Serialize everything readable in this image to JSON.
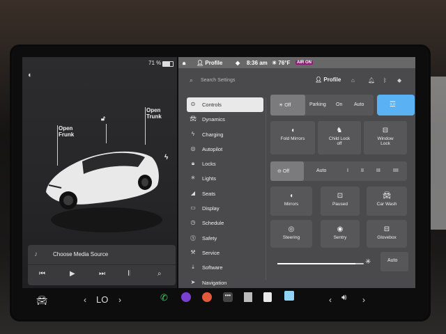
{
  "status": {
    "battery": "71 %",
    "profile_top": "Profile",
    "time": "8:36 am",
    "temp": "76°F",
    "airbag": "AIR ON"
  },
  "callouts": {
    "frunk": "Open\nFrunk",
    "trunk": "Open\nTrunk"
  },
  "media": {
    "label": "Choose Media Source"
  },
  "search": {
    "placeholder": "Search Settings"
  },
  "profile": {
    "label": "Profile"
  },
  "nav": [
    {
      "label": "Controls",
      "icon": "toggle-icon",
      "active": true
    },
    {
      "label": "Dynamics",
      "icon": "car-icon"
    },
    {
      "label": "Charging",
      "icon": "bolt-icon"
    },
    {
      "label": "Autopilot",
      "icon": "steering-icon"
    },
    {
      "label": "Locks",
      "icon": "lock-icon"
    },
    {
      "label": "Lights",
      "icon": "sun-icon"
    },
    {
      "label": "Seats",
      "icon": "seat-icon"
    },
    {
      "label": "Display",
      "icon": "display-icon"
    },
    {
      "label": "Schedule",
      "icon": "clock-icon"
    },
    {
      "label": "Safety",
      "icon": "shield-icon"
    },
    {
      "label": "Service",
      "icon": "wrench-icon"
    },
    {
      "label": "Software",
      "icon": "download-icon"
    },
    {
      "label": "Navigation",
      "icon": "navigation-icon"
    }
  ],
  "headlights": {
    "off": "Off",
    "parking": "Parking",
    "on": "On",
    "auto": "Auto"
  },
  "mirror_tiles": {
    "fold": "Fold Mirrors",
    "child": "Child Lock\noff",
    "window": "Window\nLock"
  },
  "wiper": {
    "off": "Off",
    "auto": "Auto",
    "s1": "I",
    "s2": "II",
    "s3": "III",
    "s4": "IIII"
  },
  "grid_tiles": [
    {
      "label": "Mirrors",
      "icon": "mirror-icon"
    },
    {
      "label": "Paused",
      "icon": "pause-icon"
    },
    {
      "label": "Car Wash",
      "icon": "car-wash-icon"
    },
    {
      "label": "Steering",
      "icon": "steering-wheel-icon"
    },
    {
      "label": "Sentry",
      "icon": "sentry-icon"
    },
    {
      "label": "Glovebox",
      "icon": "glovebox-icon"
    }
  ],
  "brightness": {
    "auto": "Auto",
    "level": 0.9
  },
  "dock": {
    "climate": "LO"
  }
}
